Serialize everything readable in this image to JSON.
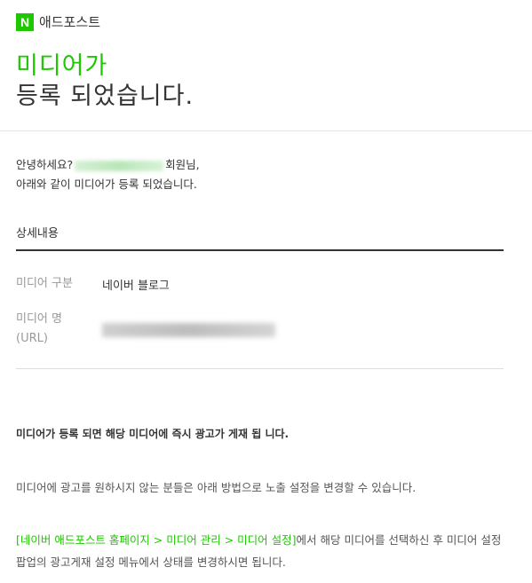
{
  "header": {
    "logo_letter": "N",
    "brand": "애드포스트",
    "title_line1": "미디어가",
    "title_line2": "등록 되었습니다."
  },
  "greeting": {
    "prefix": "안녕하세요?",
    "suffix": "회원님,",
    "line2": "아래와 같이 미디어가 등록 되었습니다."
  },
  "details": {
    "section_title": "상세내용",
    "media_type_label": "미디어 구분",
    "media_type_value": "네이버 블로그",
    "media_name_label_1": "미디어 명",
    "media_name_label_2": "(URL)"
  },
  "notice": {
    "bold": "미디어가 등록 되면 해당 미디어에 즉시 광고가 게재 됩 니다.",
    "info": "미디어에 광고를 원하시지 않는 분들은 아래 방법으로 노출 설정을 변경할 수 있습니다.",
    "path_link": "[네이버 애드포스트 홈페이지 > 미디어 관리 > 미디어 설정]",
    "path_rest": "에서 해당 미디어를 선택하신 후 미디어 설정 팝업의 광고게재 설정 메뉴에서 상태를 변경하시면 됩니다."
  },
  "colors": {
    "brand_green": "#1ec800",
    "text": "#333333",
    "label_gray": "#999999"
  }
}
